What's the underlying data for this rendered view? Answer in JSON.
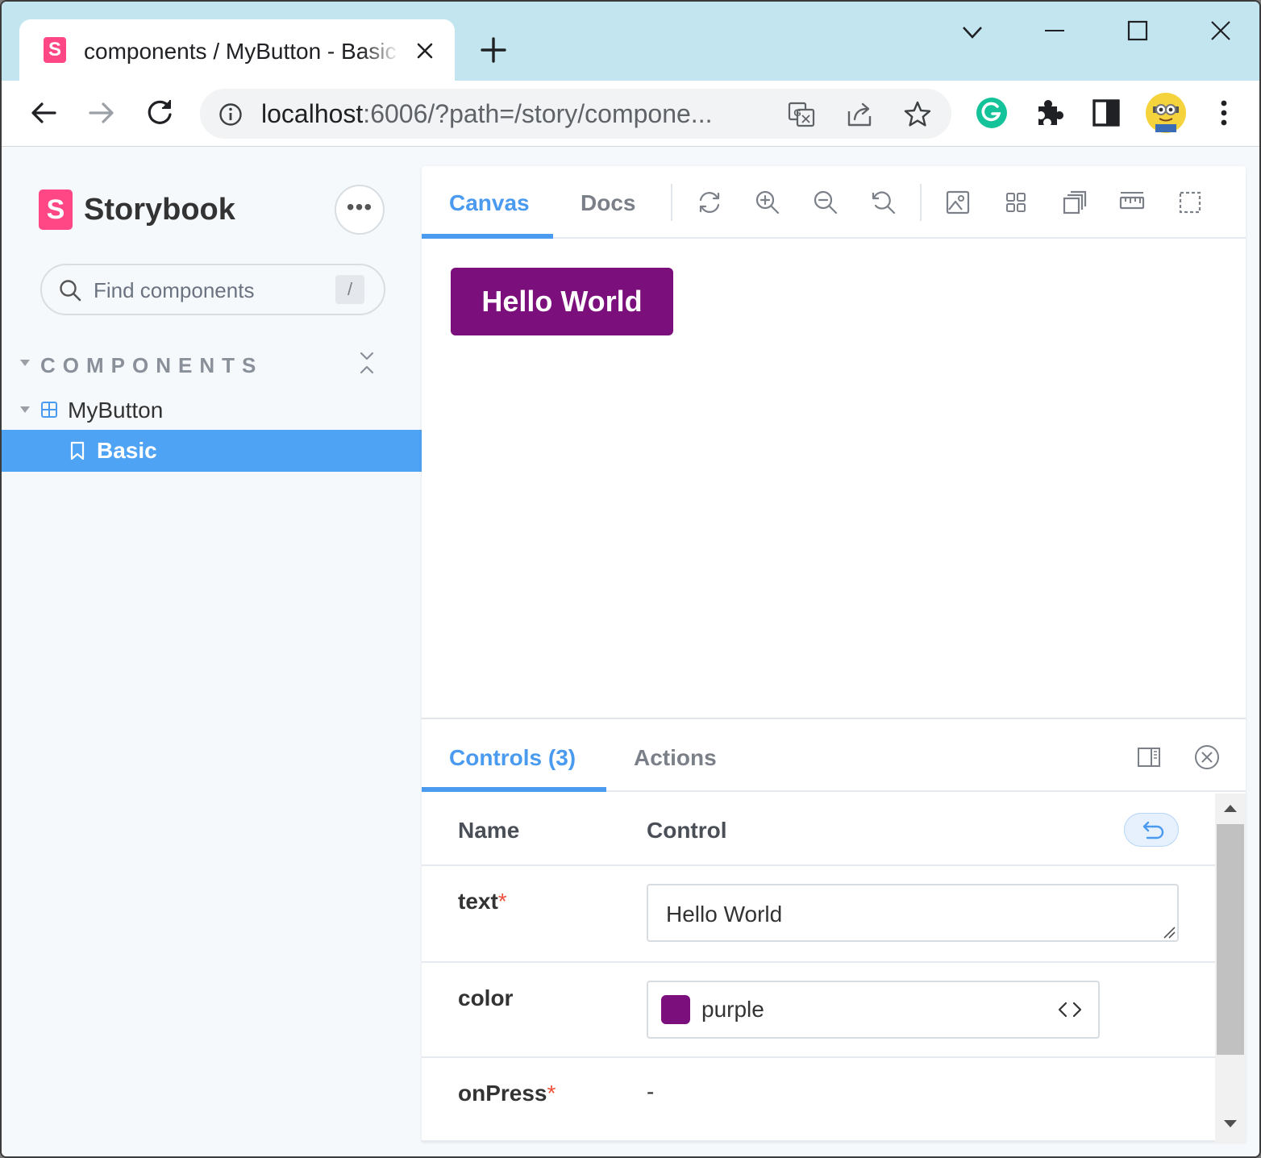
{
  "browser": {
    "tab_title": "components / MyButton - Basic",
    "tab_favicon": "S",
    "url_host": "localhost",
    "url_rest": ":6006/?path=/story/compone...",
    "icons": [
      "back-icon",
      "forward-icon",
      "reload-icon",
      "info-icon",
      "translate-icon",
      "share-icon",
      "bookmark-star-icon",
      "grammarly-icon",
      "extensions-puzzle-icon",
      "side-panel-icon",
      "profile-avatar",
      "more-vert-icon"
    ]
  },
  "sidebar": {
    "logo_letter": "S",
    "brand": "Storybook",
    "menu_label": "•••",
    "search_placeholder": "Find components",
    "search_shortcut": "/",
    "group_title": "COMPONENTS",
    "component": "MyButton",
    "story": "Basic"
  },
  "preview": {
    "tabs": [
      {
        "label": "Canvas",
        "active": true
      },
      {
        "label": "Docs",
        "active": false
      }
    ],
    "tools": [
      "reload-icon",
      "zoom-in-icon",
      "zoom-out-icon",
      "zoom-reset-icon",
      "background-icon",
      "grid-icon",
      "viewport-icon",
      "measure-icon",
      "outline-icon"
    ],
    "button_text": "Hello World",
    "button_color": "#7b0f7b"
  },
  "addons": {
    "tabs": [
      {
        "label": "Controls (3)",
        "active": true
      },
      {
        "label": "Actions",
        "active": false
      }
    ],
    "columns": {
      "name": "Name",
      "control": "Control"
    },
    "rows": [
      {
        "name": "text",
        "required": "*",
        "value": "Hello World"
      },
      {
        "name": "color",
        "required": "",
        "value": "purple",
        "swatch": "#7b0f7b"
      },
      {
        "name": "onPress",
        "required": "*",
        "value": "-"
      }
    ]
  },
  "colors": {
    "accent": "#4a9af0",
    "storybook_pink": "#ff4785",
    "tabbar_bg": "#c2e5f0",
    "required": "#ef4f3d"
  }
}
